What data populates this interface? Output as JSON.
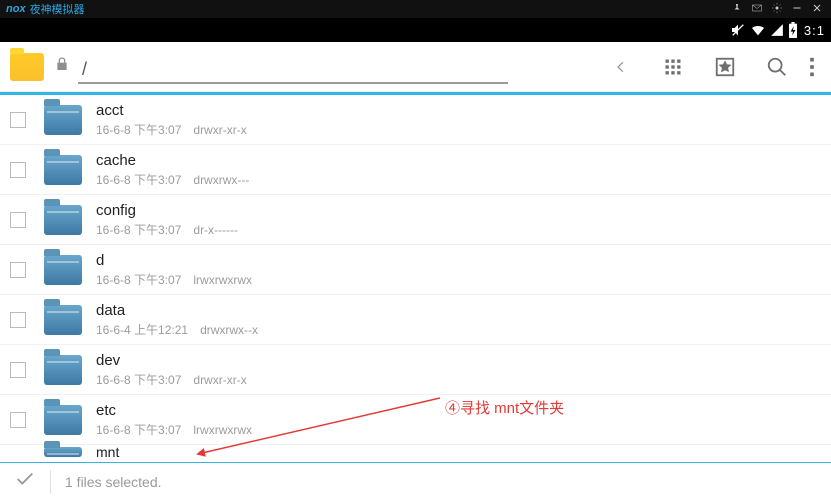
{
  "emulator": {
    "brand": "nox",
    "title": "夜神模拟器"
  },
  "status": {
    "time": "3:1"
  },
  "toolbar": {
    "path": "/"
  },
  "files": [
    {
      "name": "acct",
      "date": "16-6-8 下午3:07",
      "perm": "drwxr-xr-x"
    },
    {
      "name": "cache",
      "date": "16-6-8 下午3:07",
      "perm": "drwxrwx---"
    },
    {
      "name": "config",
      "date": "16-6-8 下午3:07",
      "perm": "dr-x------"
    },
    {
      "name": "d",
      "date": "16-6-8 下午3:07",
      "perm": "lrwxrwxrwx"
    },
    {
      "name": "data",
      "date": "16-6-4 上午12:21",
      "perm": "drwxrwx--x"
    },
    {
      "name": "dev",
      "date": "16-6-8 下午3:07",
      "perm": "drwxr-xr-x"
    },
    {
      "name": "etc",
      "date": "16-6-8 下午3:07",
      "perm": "lrwxrwxrwx"
    },
    {
      "name": "mnt",
      "date": "",
      "perm": ""
    }
  ],
  "footer": {
    "selected": "1 files selected."
  },
  "annotation": {
    "text": "④寻找 mnt文件夹"
  }
}
